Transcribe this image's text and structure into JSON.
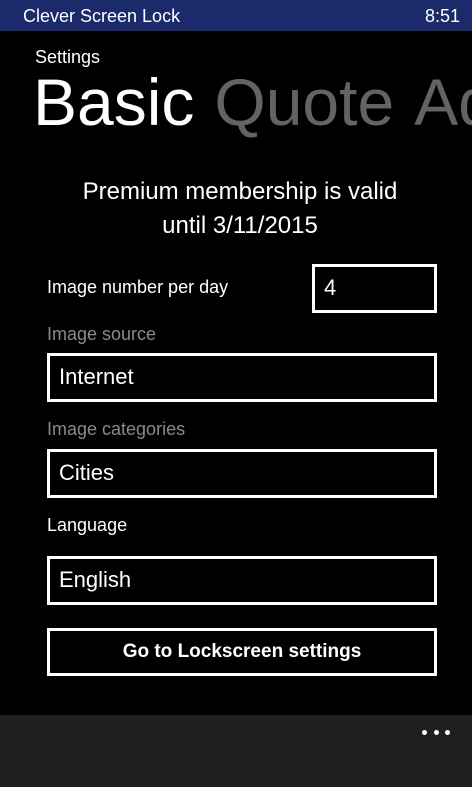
{
  "titlebar": {
    "app_title": "Clever Screen Lock",
    "time": "8:51"
  },
  "pivot": {
    "caption": "Settings",
    "headers": [
      {
        "label": "Basic",
        "active": true
      },
      {
        "label": "Quote",
        "active": false
      },
      {
        "label": "Ad",
        "active": false
      }
    ]
  },
  "premium": {
    "line1": "Premium membership is valid",
    "line2": "until 3/11/2015"
  },
  "settings": {
    "images_per_day": {
      "label": "Image number per day",
      "value": "4"
    },
    "image_source": {
      "label": "Image source",
      "value": "Internet"
    },
    "image_categories": {
      "label": "Image categories",
      "value": "Cities"
    },
    "language": {
      "label": "Language",
      "value": "English"
    }
  },
  "lockscreen_button": {
    "label": "Go to Lockscreen settings"
  },
  "appbar": {
    "more_icon": "more-ellipsis-icon"
  },
  "colors": {
    "titlebar_bg": "#1b2a6b",
    "background": "#000000",
    "inactive_header": "#636363",
    "dim_label": "#8a8a8a",
    "appbar_bg": "#1f1f1f"
  }
}
